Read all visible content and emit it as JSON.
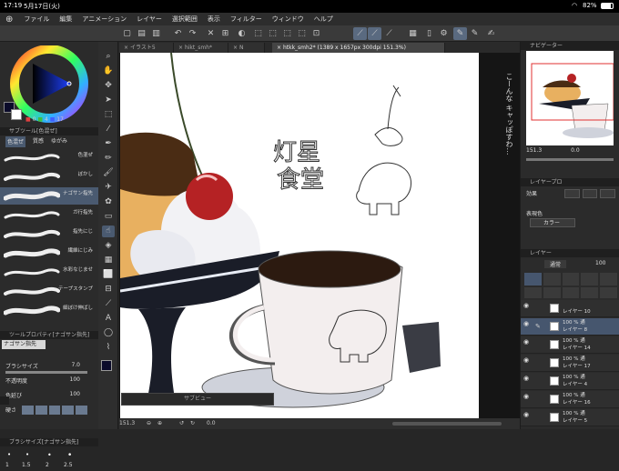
{
  "status": {
    "time": "17:19",
    "date": "5月17日(火)",
    "battery": "82%"
  },
  "menu": [
    "ファイル",
    "編集",
    "アニメーション",
    "レイヤー",
    "選択範囲",
    "表示",
    "フィルター",
    "ウィンドウ",
    "ヘルプ"
  ],
  "tabs": [
    {
      "label": "イラスト5"
    },
    {
      "label": "hikt_smh*"
    },
    {
      "label": "N"
    },
    {
      "label": "htkk_smh2* (1389 x 1657px 300dpi 151.3%)"
    }
  ],
  "color_values": {
    "a": "0",
    "b": "4",
    "c": "17"
  },
  "subtool": {
    "header": "サブツール[色混ぜ]",
    "tabs": [
      "色混ぜ",
      "質感",
      "ゆがみ"
    ],
    "brushes": [
      "色混ぜ",
      "ぼかし",
      "ナゴサン指先",
      "ガ行指先",
      "指先にじ",
      "繊維にじみ",
      "水彩なじませ",
      "テープスタンプ",
      "細ぼけ伸ばし"
    ]
  },
  "tool_property": {
    "header": "ツールプロパティ[ナゴサン指先]",
    "name": "ナゴサン指先",
    "rows": [
      {
        "label": "ブラシサイズ",
        "value": "7.0"
      },
      {
        "label": "不透明度",
        "value": "100"
      },
      {
        "label": "色延び",
        "value": "100"
      },
      {
        "label": "硬さ",
        "value": ""
      }
    ]
  },
  "brush_size_panel": {
    "header": "ブラシサイズ[ナゴサン指先]",
    "sizes": [
      "1",
      "1.5",
      "2",
      "2.5"
    ]
  },
  "subview_label": "サブビュー",
  "navigator": {
    "header": "ナビゲーター",
    "zoom": "151.3",
    "angle": "0.0"
  },
  "layer_property": {
    "header": "レイヤープロ",
    "effect_label": "効果",
    "display_color_label": "表現色",
    "display_color_value": "カラー"
  },
  "layers_panel": {
    "header": "レイヤー",
    "blend": "通常",
    "opacity": "100",
    "rows": [
      {
        "name": "レイヤー 10",
        "mode": "",
        "sel": false
      },
      {
        "name": "レイヤー 8",
        "mode": "100 % 通",
        "sel": true
      },
      {
        "name": "レイヤー 14",
        "mode": "100 % 通",
        "sel": false
      },
      {
        "name": "レイヤー 17",
        "mode": "100 % 通",
        "sel": false
      },
      {
        "name": "レイヤー 4",
        "mode": "100 % 通",
        "sel": false
      },
      {
        "name": "レイヤー 16",
        "mode": "100 % 通",
        "sel": false
      },
      {
        "name": "レイヤー 5",
        "mode": "100 % 通",
        "sel": false
      }
    ]
  },
  "bottombar": {
    "zoom": "151.3",
    "angle": "0.0"
  },
  "canvas_text": {
    "sign_a": "灯星",
    "sign_b": "食堂",
    "note": "こーんな\nキャッぽすわ…"
  }
}
